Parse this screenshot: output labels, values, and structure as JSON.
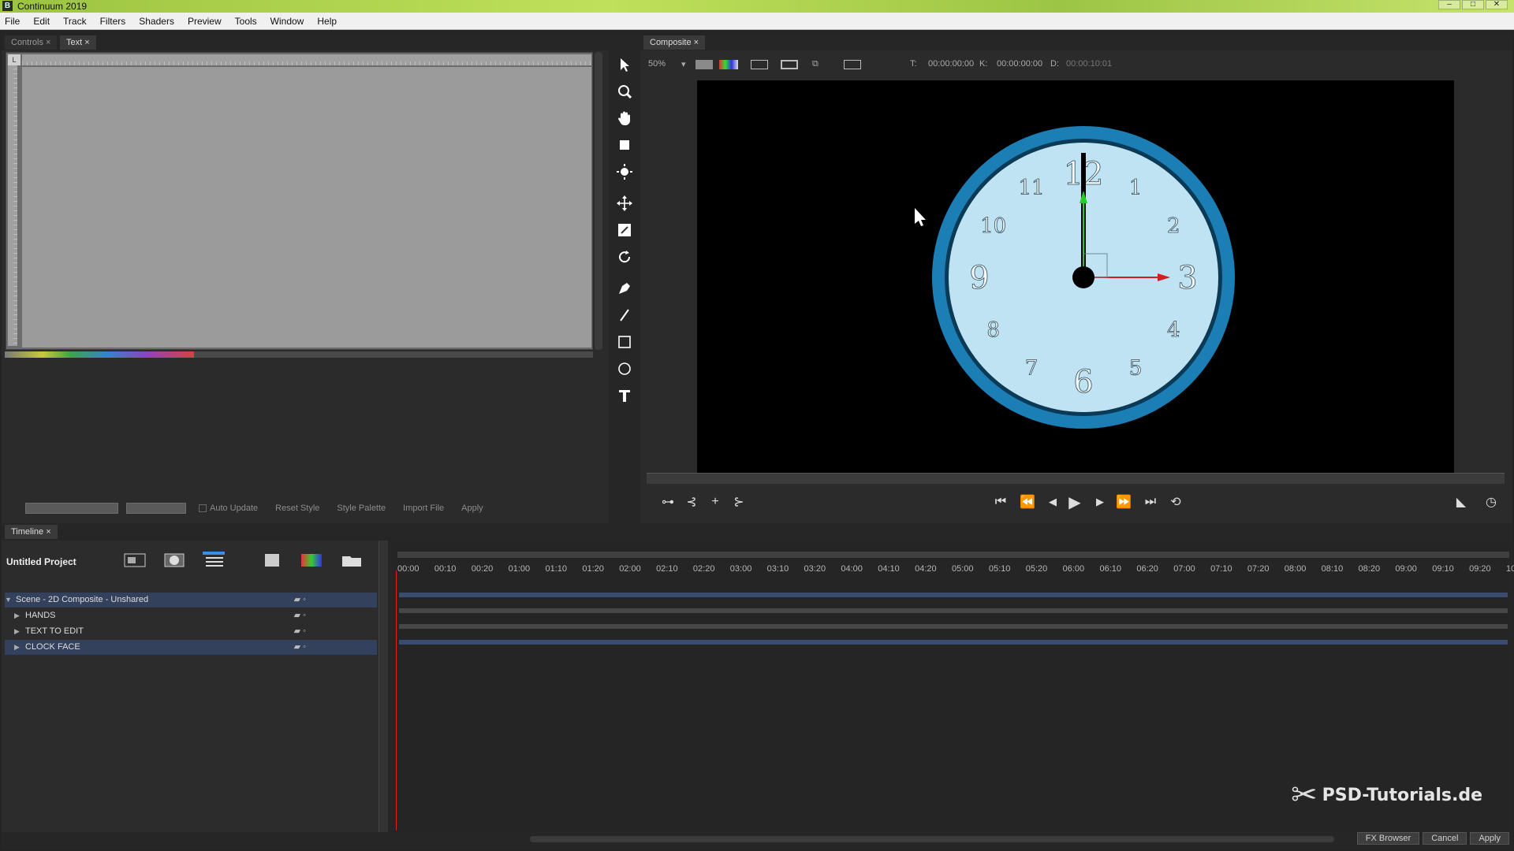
{
  "window": {
    "title": "Continuum 2019",
    "app_icon": "B"
  },
  "menu": [
    "File",
    "Edit",
    "Track",
    "Filters",
    "Shaders",
    "Preview",
    "Tools",
    "Window",
    "Help"
  ],
  "controls_panel": {
    "tabs": [
      "Controls",
      "Text"
    ],
    "auto_update_label": "Auto Update",
    "reset_style_label": "Reset Style",
    "style_palette_label": "Style Palette",
    "import_file_label": "Import File",
    "apply_label": "Apply"
  },
  "composite_panel": {
    "tab": "Composite",
    "zoom": "50%",
    "time_t_label": "T:",
    "time_t": "00:00:00:00",
    "time_k_label": "K:",
    "time_k": "00:00:00:00",
    "time_d_label": "D:",
    "time_d": "00:00:10:01",
    "clock_numbers": [
      "12",
      "1",
      "2",
      "3",
      "4",
      "5",
      "6",
      "7",
      "8",
      "9",
      "10",
      "11"
    ],
    "colors": {
      "ring": "#1b7fb5",
      "face": "#bfe3f2",
      "hand_x": "#d21f1f",
      "hand_y": "#1fd21f"
    }
  },
  "timeline": {
    "tab": "Timeline",
    "project_name": "Untitled Project",
    "ticks": [
      "00:00",
      "00:10",
      "00:20",
      "01:00",
      "01:10",
      "01:20",
      "02:00",
      "02:10",
      "02:20",
      "03:00",
      "03:10",
      "03:20",
      "04:00",
      "04:10",
      "04:20",
      "05:00",
      "05:10",
      "05:20",
      "06:00",
      "06:10",
      "06:20",
      "07:00",
      "07:10",
      "07:20",
      "08:00",
      "08:10",
      "08:20",
      "09:00",
      "09:10",
      "09:20",
      "10"
    ],
    "tracks": [
      {
        "label": "Scene - 2D Composite - Unshared",
        "selected": true
      },
      {
        "label": "HANDS",
        "selected": false
      },
      {
        "label": "TEXT TO EDIT",
        "selected": false
      },
      {
        "label": "CLOCK FACE",
        "selected": true
      }
    ]
  },
  "bottom_buttons": {
    "fx_browser": "FX Browser",
    "cancel": "Cancel",
    "apply": "Apply"
  },
  "watermark": "PSD-Tutorials.de"
}
